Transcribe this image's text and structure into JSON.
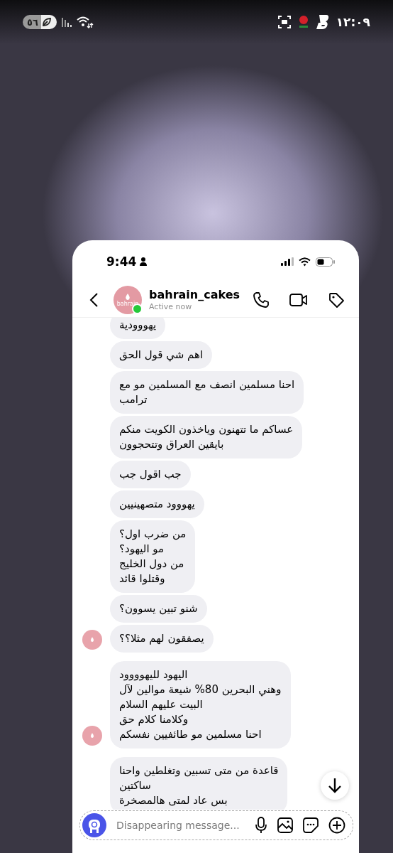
{
  "system_status": {
    "battery": "٥٦",
    "time": "١٢:٠٩"
  },
  "chat": {
    "status_bar": {
      "time": "9:44"
    },
    "header": {
      "avatar_text": "bahrain",
      "username": "bahrain_cakes",
      "presence": "Active now",
      "online": true
    },
    "messages": [
      {
        "text": "يهووودية",
        "avatar": false
      },
      {
        "text": "اهم شي قول الحق",
        "avatar": false
      },
      {
        "text": "احنا مسلمين انصف مع المسلمين مو مع\nترامب",
        "avatar": false
      },
      {
        "text": "عساكم ما تتهنون وياخذون الكويت منكم\nبايقين العراق وتتحجوون",
        "avatar": false
      },
      {
        "text": "جب اقول جب",
        "avatar": false
      },
      {
        "text": "يهووود متصهينيين",
        "avatar": false
      },
      {
        "text": "من ضرب اول؟\nمو اليهود؟\nمن دول الخليج\nوقتلوا قائد",
        "avatar": false
      },
      {
        "text": "شنو تبين يسوون؟",
        "avatar": false
      },
      {
        "text": "يصفقون لهم مثلا؟؟",
        "avatar": true
      },
      {
        "text": "اليهود لليهوووود\nوهني البحرين 80% شيعة موالين لآل\nالبيت عليهم السلام\nوكلامنا كلام حق\nاحنا مسلمين مو طائفيين نفسكم",
        "avatar": true
      },
      {
        "text": "قاعدة من متى تسبين وتغلطين واحنا\nساكتين\nبس عاد لمتى هالمصخرة",
        "avatar": false
      }
    ],
    "composer": {
      "placeholder": "Disappearing message..."
    }
  }
}
